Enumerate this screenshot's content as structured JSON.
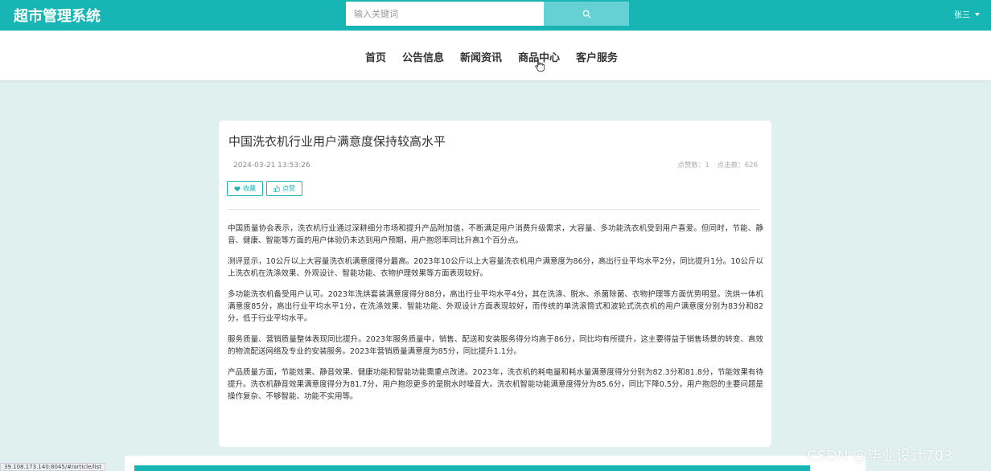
{
  "header": {
    "app_title": "超市管理系统",
    "search_placeholder": "输入关键词",
    "search_value": "",
    "user_name": "张三"
  },
  "nav": {
    "items": [
      "首页",
      "公告信息",
      "新闻资讯",
      "商品中心",
      "客户服务"
    ]
  },
  "article": {
    "title": "中国洗衣机行业用户满意度保持较高水平",
    "date": "2024-03-21 13:53:26",
    "likes_label": "点赞数：1",
    "clicks_label": "点击数：626",
    "favorite_label": "收藏",
    "like_label": "点赞",
    "paragraphs": [
      "中国质量协会表示，洗衣机行业通过深耕细分市场和提升产品附加值，不断满足用户消费升级需求，大容量、多功能洗衣机受到用户喜爱。但同时，节能、静音、健康、智能等方面的用户体验仍未达到用户预期，用户抱怨率同比升高1个百分点。",
      "测评显示，10公斤以上大容量洗衣机满意度得分最高。2023年10公斤以上大容量洗衣机用户满意度为86分，高出行业平均水平2分，同比提升1分。10公斤以上洗衣机在洗涤效果、外观设计、智能功能、衣物护理效果等方面表现较好。",
      "多功能洗衣机备受用户认可。2023年洗烘套装满意度得分88分，高出行业平均水平4分，其在洗涤、脱水、杀菌除菌、衣物护理等方面优势明显。洗烘一体机满意度85分，高出行业平均水平1分，在洗涤效果、智能功能、外观设计方面表现较好，而传统的单洗滚筒式和波轮式洗衣机的用户满意度分别为83分和82分，低于行业平均水平。",
      "服务质量、营销质量整体表现同比提升。2023年服务质量中，销售、配送和安装服务得分均高于86分，同比均有所提升，这主要得益于销售场景的转变、高效的物流配送网络及专业的安装服务。2023年营销质量满意度为85分，同比提升1.1分。",
      "产品质量方面，节能效果、静音效果、健康功能和智能功能需重点改进。2023年，洗衣机的耗电量和耗水量满意度得分分别为82.3分和81.8分，节能效果有待提升。洗衣机静音效果满意度得分为81.7分，用户抱怨更多的是脱水时噪音大。洗衣机智能功能满意度得分为85.6分，同比下降0.5分，用户抱怨的主要问题是操作复杂、不够智能、功能不实用等。"
    ]
  },
  "status_bar": {
    "url": "39.108.173.140:8045/#/article/list"
  },
  "watermark": "CSDN @毕业设计703",
  "colors": {
    "primary": "#17b6b4",
    "search_button": "#65d1d4",
    "background": "#dff0ef"
  }
}
